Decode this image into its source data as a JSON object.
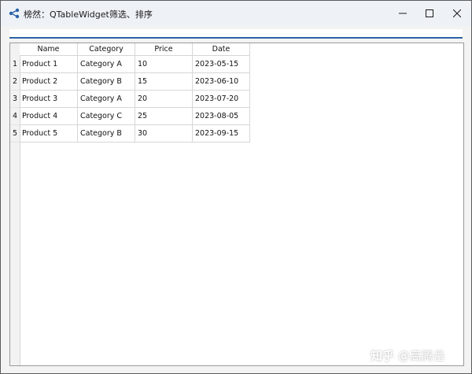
{
  "window": {
    "title": "榜然：QTableWidget筛选、排序"
  },
  "filter": {
    "value": "",
    "placeholder": ""
  },
  "table": {
    "columns": [
      "Name",
      "Category",
      "Price",
      "Date"
    ],
    "row_numbers": [
      "1",
      "2",
      "3",
      "4",
      "5"
    ],
    "rows": [
      [
        "Product 1",
        "Category A",
        "10",
        "2023-05-15"
      ],
      [
        "Product 2",
        "Category B",
        "15",
        "2023-06-10"
      ],
      [
        "Product 3",
        "Category A",
        "20",
        "2023-07-20"
      ],
      [
        "Product 4",
        "Category C",
        "25",
        "2023-08-05"
      ],
      [
        "Product 5",
        "Category B",
        "30",
        "2023-09-15"
      ]
    ]
  },
  "watermark": {
    "logo": "知乎",
    "author": "@高腾岳"
  },
  "colors": {
    "accent": "#2a63a8",
    "titlebar": "#eef2f7",
    "grid": "#d6d6d6"
  },
  "icons": {
    "app": "share-nodes-icon",
    "minimize": "minimize-icon",
    "maximize": "maximize-icon",
    "close": "close-icon"
  }
}
